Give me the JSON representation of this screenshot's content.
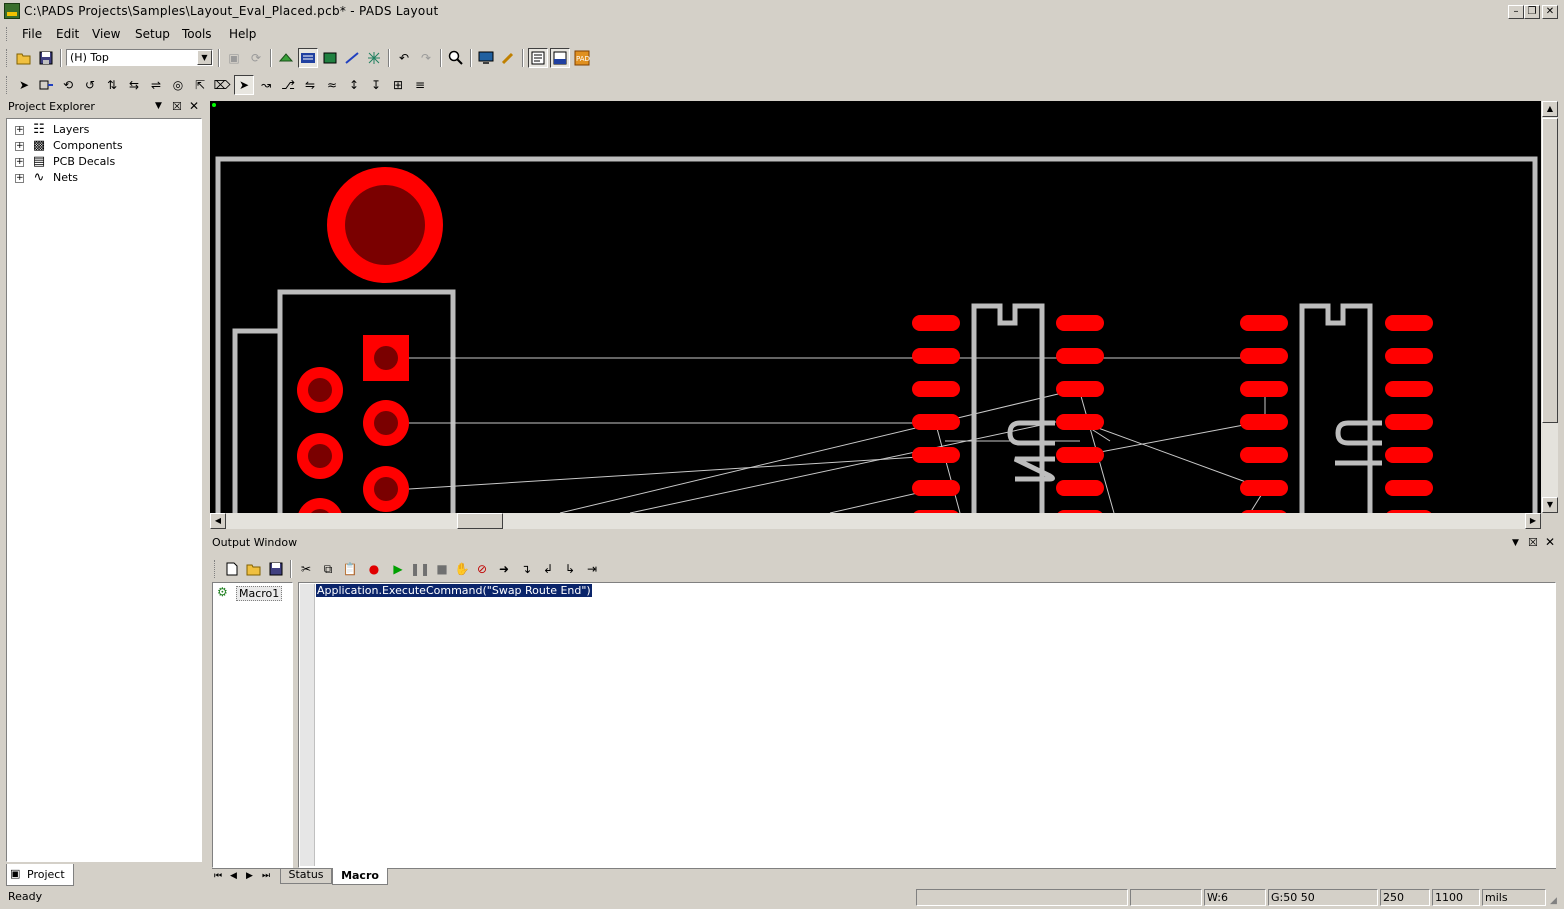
{
  "window": {
    "title": "C:\\PADS Projects\\Samples\\Layout_Eval_Placed.pcb* - PADS Layout",
    "app_icon": "pads-icon",
    "controls": [
      "minimize-icon",
      "restore-icon",
      "close-icon"
    ]
  },
  "menu": [
    "File",
    "Edit",
    "View",
    "Setup",
    "Tools",
    "Help"
  ],
  "toolbar": {
    "layer_value": "(H) Top"
  },
  "project_explorer": {
    "title": "Project Explorer",
    "items": [
      {
        "label": "Layers",
        "icon": "layers-icon"
      },
      {
        "label": "Components",
        "icon": "component-icon"
      },
      {
        "label": "PCB Decals",
        "icon": "decal-icon"
      },
      {
        "label": "Nets",
        "icon": "nets-icon"
      }
    ],
    "tab": "Project"
  },
  "pcb": {
    "colors": {
      "background": "#000000",
      "pad": "#ff0000",
      "drill": "#7a0000",
      "outline": "#bdbdbd",
      "ratsnest": "#c8c8c8",
      "origin": "#00ff00"
    },
    "component_labels": [
      "U2",
      "U1"
    ]
  },
  "output_window": {
    "title": "Output Window",
    "macro_name": "Macro1",
    "code": "Application.ExecuteCommand(\"Swap Route End\")",
    "tabs": [
      "Status",
      "Macro"
    ],
    "active_tab": "Macro"
  },
  "status": {
    "text": "Ready",
    "width": "W:6",
    "grid": "G:50 50",
    "x": "250",
    "y": "1100",
    "units": "mils"
  }
}
